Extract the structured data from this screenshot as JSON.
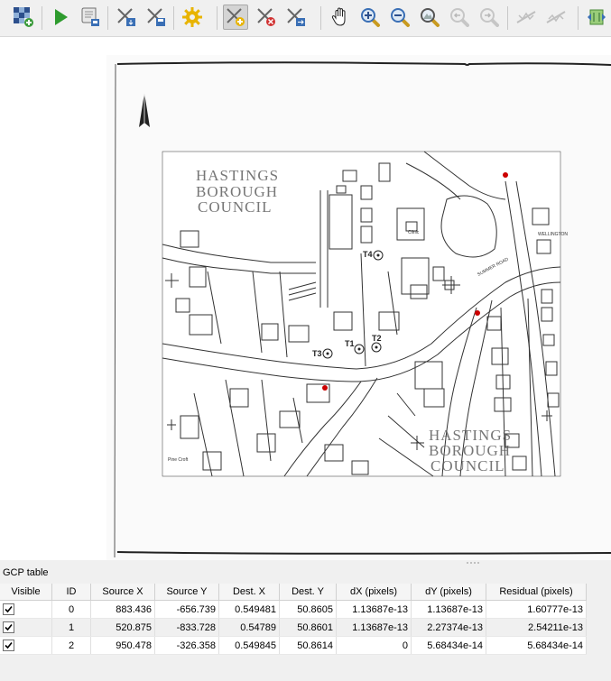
{
  "gcp_panel": {
    "title": "GCP table",
    "columns": [
      "Visible",
      "ID",
      "Source X",
      "Source Y",
      "Dest. X",
      "Dest. Y",
      "dX (pixels)",
      "dY (pixels)",
      "Residual (pixels)"
    ],
    "rows": [
      {
        "visible": true,
        "id": "0",
        "source_x": "883.436",
        "source_y": "-656.739",
        "dest_x": "0.549481",
        "dest_y": "50.8605",
        "dx": "1.13687e-13",
        "dy": "1.13687e-13",
        "residual": "1.60777e-13"
      },
      {
        "visible": true,
        "id": "1",
        "source_x": "520.875",
        "source_y": "-833.728",
        "dest_x": "0.54789",
        "dest_y": "50.8601",
        "dx": "1.13687e-13",
        "dy": "2.27374e-13",
        "residual": "2.54211e-13"
      },
      {
        "visible": true,
        "id": "2",
        "source_x": "950.478",
        "source_y": "-326.358",
        "dest_x": "0.549845",
        "dest_y": "50.8614",
        "dx": "0",
        "dy": "5.68434e-14",
        "residual": "5.68434e-14"
      }
    ]
  },
  "map": {
    "watermark_top": [
      "HASTINGS",
      "BOROUGH",
      "COUNCIL"
    ],
    "watermark_bottom": [
      "HASTINGS",
      "BOROUGH",
      "COUNCIL"
    ],
    "point_labels": [
      "T4",
      "T2",
      "T1",
      "T3"
    ],
    "road_labels": [
      "Clinic",
      "Pine Croft",
      "SUMMER ROAD",
      "WELLINGTON"
    ],
    "gcp_color": "#cc0000"
  },
  "toolbar": {
    "icons": [
      "open-raster-icon",
      "start-georeferencing-icon",
      "generate-gdal-script-icon",
      "load-gcp-points-icon",
      "save-gcp-points-icon",
      "transformation-settings-icon",
      "add-point-icon",
      "delete-point-icon",
      "move-gcp-point-icon",
      "pan-icon",
      "zoom-in-icon",
      "zoom-out-icon",
      "zoom-to-layer-icon",
      "zoom-last-icon",
      "zoom-next-icon",
      "link-georeferencer-to-qgis-icon",
      "link-qgis-to-georeferencer-icon",
      "full-histogram-stretch-icon"
    ]
  }
}
